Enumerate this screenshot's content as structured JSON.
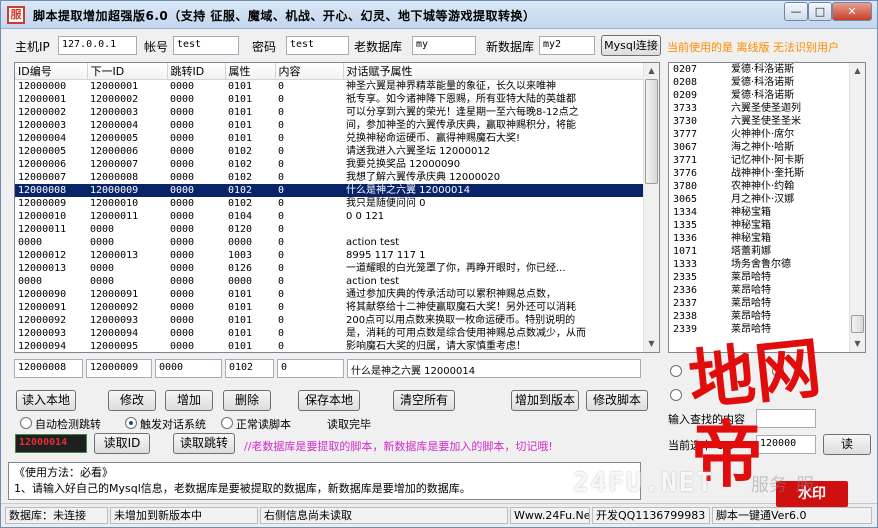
{
  "window": {
    "title": "脚本提取增加超强版6.0（支持 征服、魔域、机战、开心、幻灵、地下城等游戏提取转换）",
    "icon_char": "服",
    "min_glyph": "—",
    "max_glyph": "□",
    "close_glyph": "✕"
  },
  "connection": {
    "host_label": "主机IP",
    "host_value": "127.0.0.1",
    "user_label": "帐号",
    "user_value": "test",
    "pass_label": "密码",
    "pass_value": "test",
    "old_db_label": "老数据库",
    "old_db_value": "my",
    "new_db_label": "新数据库",
    "new_db_value": "my2",
    "connect_button": "Mysql连接",
    "version_status": "当前使用的是 离线版 无法识别用户"
  },
  "grid": {
    "columns": [
      "ID编号",
      "下一ID",
      "跳转ID",
      "属性",
      "内容",
      "对话赋予属性"
    ],
    "rows": [
      [
        "12000000",
        "12000001",
        "0000",
        "0101",
        "0",
        "        神圣六翼是神界精萃能量的象征，长久以来唯神"
      ],
      [
        "12000001",
        "12000002",
        "0000",
        "0101",
        "0",
        "祇专享。如今诸神降下恩赐，所有亚特大陆的英雄都"
      ],
      [
        "12000002",
        "12000003",
        "0000",
        "0101",
        "0",
        "可以分享到六翼的荣光！逢星期一至六每晚8-12点之"
      ],
      [
        "12000003",
        "12000004",
        "0000",
        "0101",
        "0",
        "间，参加神圣的六翼传承庆典，赢取神赐积分，将能"
      ],
      [
        "12000004",
        "12000005",
        "0000",
        "0101",
        "0",
        "兑换神秘命运硬币、赢得神赐魔石大奖!"
      ],
      [
        "12000005",
        "12000006",
        "0000",
        "0102",
        "0",
        "请送我进入六翼圣坛 12000012"
      ],
      [
        "12000006",
        "12000007",
        "0000",
        "0102",
        "0",
        "我要兑换奖品 12000090"
      ],
      [
        "12000007",
        "12000008",
        "0000",
        "0102",
        "0",
        "我想了解六翼传承庆典 12000020"
      ],
      [
        "12000008",
        "12000009",
        "0000",
        "0102",
        "0",
        "什么是神之六翼 12000014"
      ],
      [
        "12000009",
        "12000010",
        "0000",
        "0102",
        "0",
        "我只是随便问问 0"
      ],
      [
        "12000010",
        "12000011",
        "0000",
        "0104",
        "0",
        "0 0 121"
      ],
      [
        "12000011",
        "0000",
        "0000",
        "0120",
        "0",
        ""
      ],
      [
        "0000",
        "0000",
        "0000",
        "0000",
        "0",
        "action test"
      ],
      [
        "12000012",
        "12000013",
        "0000",
        "1003",
        "0",
        "8995 117 117 1"
      ],
      [
        "12000013",
        "0000",
        "0000",
        "0126",
        "0",
        "一道耀眼的白光笼罩了你，再睁开眼时，你已经..."
      ],
      [
        "0000",
        "0000",
        "0000",
        "0000",
        "0",
        "action test"
      ],
      [
        "12000090",
        "12000091",
        "0000",
        "0101",
        "0",
        "        通过参加庆典的传承活动可以累积神赐总点数，"
      ],
      [
        "12000091",
        "12000092",
        "0000",
        "0101",
        "0",
        "将其献祭给十二神使赢取魔石大奖！另外还可以消耗"
      ],
      [
        "12000092",
        "12000093",
        "0000",
        "0101",
        "0",
        "200点可以用点数来换取一枚命运硬币。特别说明的"
      ],
      [
        "12000093",
        "12000094",
        "0000",
        "0101",
        "0",
        "是，消耗的可用点数是综合使用神赐总点数减少，从而"
      ],
      [
        "12000094",
        "12000095",
        "0000",
        "0101",
        "0",
        "影响魔石大奖的归属，请大家慎重考虑！"
      ]
    ],
    "selected_row_index": 8
  },
  "right_list": {
    "rows": [
      [
        "0207",
        "爱德·科洛诺斯"
      ],
      [
        "0208",
        "爱德·科洛诺斯"
      ],
      [
        "0209",
        "爱德·科洛诺斯"
      ],
      [
        "3733",
        "六翼圣使圣迦列"
      ],
      [
        "3730",
        "六翼圣使圣圣米"
      ],
      [
        "3777",
        "火神神仆·席尔"
      ],
      [
        "3067",
        "海之神仆·哈斯"
      ],
      [
        "3771",
        "记忆神仆·阿卡斯"
      ],
      [
        "3776",
        "战神神仆·奎托斯"
      ],
      [
        "3780",
        "农神神仆·约翰"
      ],
      [
        "3065",
        "月之神仆·汉娜"
      ],
      [
        "1334",
        "神秘宝箱"
      ],
      [
        "1335",
        "神秘宝箱"
      ],
      [
        "1336",
        "神秘宝箱"
      ],
      [
        "1071",
        "塔蕾莉娜"
      ],
      [
        "1333",
        "场务舍鲁尔德"
      ],
      [
        "2335",
        "莱昂哈特"
      ],
      [
        "2336",
        "莱昂哈特"
      ],
      [
        "2337",
        "莱昂哈特"
      ],
      [
        "2338",
        "莱昂哈特"
      ],
      [
        "2339",
        "莱昂哈特"
      ]
    ]
  },
  "edit_row": {
    "id": "12000008",
    "next_id": "12000009",
    "jump_id": "0000",
    "attr": "0102",
    "content": "0",
    "dialog": "什么是神之六翼 12000014"
  },
  "actions": {
    "read_local": "读入本地",
    "modify": "修改",
    "add": "增加",
    "delete": "删除",
    "save_local": "保存本地",
    "clear_all": "清空所有",
    "add_to_version": "增加到版本",
    "modify_script": "修改脚本"
  },
  "options": {
    "auto_detect": "自动检测跳转",
    "trigger_dialog": "触发对话系统",
    "normal_read": "正常读脚本",
    "read_status": "读取完毕"
  },
  "read_bar": {
    "id_value": "12000014",
    "read_id_button": "读取ID",
    "read_jump_button": "读取跳转",
    "warning": "//老数据库是要提取的脚本，新数据库是要加入的脚本，切记哦!"
  },
  "right_panel": {
    "search_label": "输入查找的内容",
    "current_id_label": "当前选中 CID",
    "current_id_value": "120000",
    "read_button": "读"
  },
  "help": {
    "title": "《使用方法：必看》",
    "line1": "1、请输入好自己的Mysql信息，老数据库是要被提取的数据库，新数据库是要增加的数据库。"
  },
  "statusbar": {
    "db_status": "数据库：未连接",
    "add_status": "未增加到新版本中",
    "right_status": "右侧信息尚未读取",
    "site": "Www.24Fu.Net",
    "qq": "开发QQ1136799983",
    "version": "脚本一键通Ver6.0"
  },
  "watermark": {
    "big_text": "地网",
    "big_text2": "帝",
    "badge": "水印",
    "site": "24FU.NET",
    "site_tail": "服务 服"
  },
  "colors": {
    "selection": "#0a246a",
    "warning": "#d02cc8",
    "status_orange": "#ff8c00",
    "watermark_red": "#e10d0d",
    "id_box_bg": "#1f1f1f",
    "id_box_text": "#e03030"
  }
}
